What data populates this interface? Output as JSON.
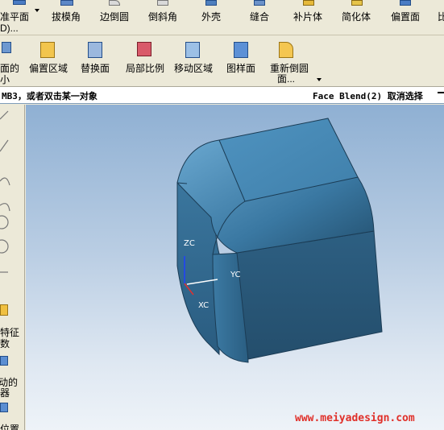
{
  "toolbar_row1": {
    "datum_plane": "准平面",
    "datum_plane_sub": "D)...",
    "draft": "拔模角",
    "edge_blend": "边倒圆",
    "chamfer": "倒斜角",
    "shell": "外壳",
    "sew": "缝合",
    "patch_body": "补片体",
    "simplify_body": "简化体",
    "offset_face": "偏置面",
    "ratio": "比"
  },
  "toolbar_row2": {
    "face_partial_1": "面的",
    "face_partial_2": "小",
    "offset_region": "偏置区域",
    "replace_face": "替换面",
    "local_scale": "局部比例",
    "move_region": "移动区域",
    "pattern_face": "图样面",
    "reblend_1": "重新倒圆",
    "reblend_2": "面..."
  },
  "cue_line": {
    "prompt": "MB3，或者双击某一对象",
    "status": "Face Blend(2) 取消选择"
  },
  "sidebar": {
    "feature_params_1": "特征",
    "feature_params_2": "数",
    "move_1": "移动的",
    "move_2": "器",
    "position": "位置"
  },
  "viewport": {
    "axis_zc": "ZC",
    "axis_yc": "YC",
    "axis_xc": "XC"
  },
  "watermark": "www.meiyadesign.com"
}
